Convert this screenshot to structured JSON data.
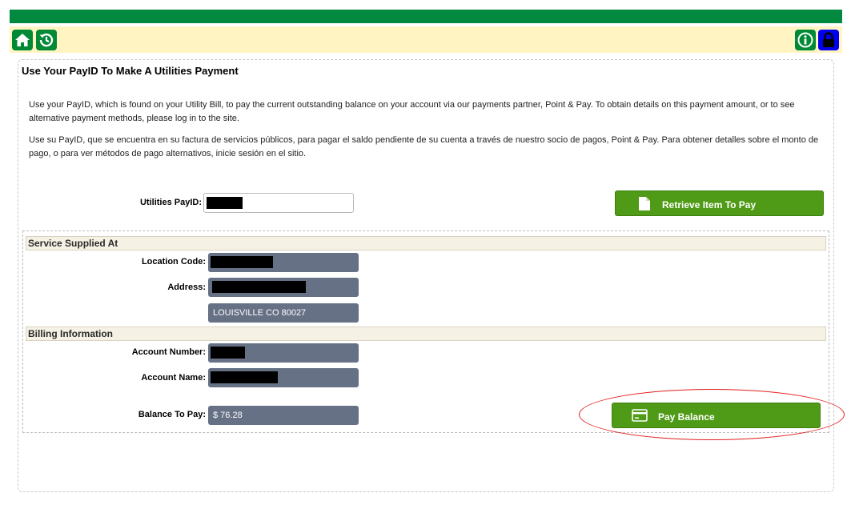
{
  "toolbar": {
    "left_icons": [
      "home-icon",
      "history-icon"
    ],
    "right_icons": [
      "info-icon",
      "lock-icon"
    ]
  },
  "page": {
    "title": "Use Your PayID To Make A Utilities Payment",
    "intro_en": "Use your PayID, which is found on your Utility Bill, to pay the current outstanding balance on your account via our payments partner, Point & Pay. To obtain details on this payment amount, or to see alternative payment methods, please log in to the site.",
    "intro_es": "Use su PayID, que se encuentra en su factura de servicios públicos, para pagar el saldo pendiente de su cuenta a través de nuestro socio de pagos, Point & Pay. Para obtener detalles sobre el monto de pago, o para ver métodos de pago alternativos, inicie sesión en el sitio."
  },
  "payid": {
    "label": "Utilities PayID:",
    "retrieve_button": "Retrieve Item To Pay",
    "retrieve_icon": "document-icon"
  },
  "service": {
    "header": "Service Supplied At",
    "location_label": "Location Code:",
    "address_label": "Address:",
    "address_line2": "LOUISVILLE CO 80027"
  },
  "billing": {
    "header": "Billing Information",
    "account_number_label": "Account Number:",
    "account_name_label": "Account Name:",
    "balance_label": "Balance To Pay:",
    "balance_value": "$ 76.28",
    "pay_button": "Pay Balance",
    "pay_icon": "credit-card-icon"
  },
  "colors": {
    "brand_green": "#00893f",
    "toolbar_bg": "#fff4c2",
    "button_green": "#4f9a16",
    "field_bg": "#667185",
    "highlight_red": "#e31e1e"
  }
}
